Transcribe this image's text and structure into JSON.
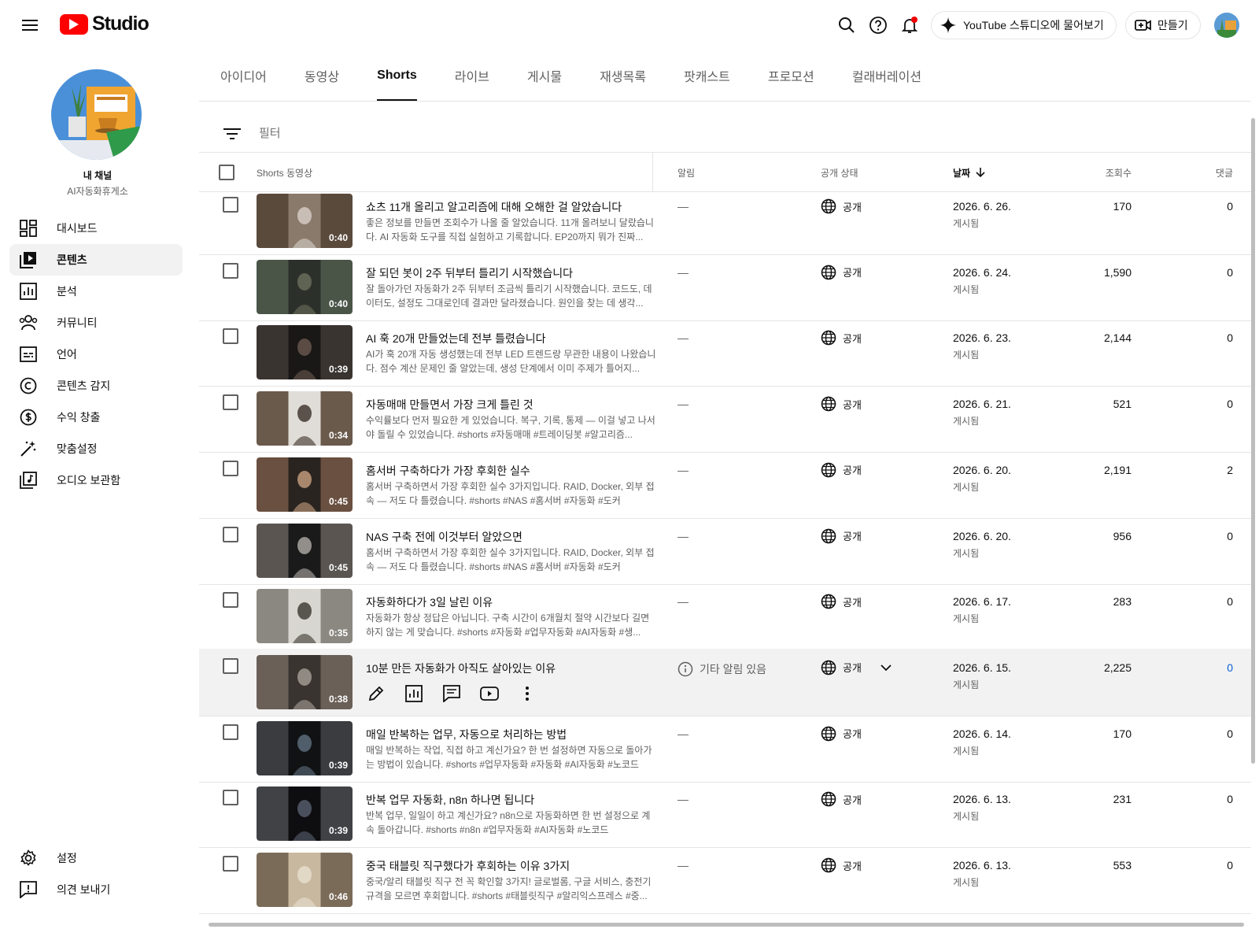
{
  "header": {
    "logo_text": "Studio",
    "ask_label": "YouTube 스튜디오에 물어보기",
    "create_label": "만들기"
  },
  "sidebar": {
    "channel_title": "내 채널",
    "channel_name": "AI자동화휴게소",
    "items": [
      {
        "label": "대시보드",
        "icon": "dashboard-icon"
      },
      {
        "label": "콘텐츠",
        "icon": "content-icon"
      },
      {
        "label": "분석",
        "icon": "analytics-icon"
      },
      {
        "label": "커뮤니티",
        "icon": "community-icon"
      },
      {
        "label": "언어",
        "icon": "subtitles-icon"
      },
      {
        "label": "콘텐츠 감지",
        "icon": "copyright-icon"
      },
      {
        "label": "수익 창출",
        "icon": "dollar-icon"
      },
      {
        "label": "맞춤설정",
        "icon": "magic-wand-icon"
      },
      {
        "label": "오디오 보관함",
        "icon": "audio-library-icon"
      }
    ],
    "settings_label": "설정",
    "feedback_label": "의견 보내기"
  },
  "tabs": [
    "아이디어",
    "동영상",
    "Shorts",
    "라이브",
    "게시물",
    "재생목록",
    "팟캐스트",
    "프로모션",
    "컬래버레이션"
  ],
  "active_tab": "Shorts",
  "filter": {
    "placeholder": "필터"
  },
  "table": {
    "headers": {
      "video": "Shorts 동영상",
      "alerts": "알림",
      "visibility": "공개 상태",
      "date": "날짜",
      "views": "조회수",
      "comments": "댓글"
    },
    "rows": [
      {
        "title": "쇼츠 11개 올리고 알고리즘에 대해 오해한 걸 알았습니다",
        "desc": "좋은 정보를 만들면 조회수가 나올 줄 알았습니다. 11개 올려보니 달랐습니다. AI 자동화 도구를 직접 실험하고 기록합니다. EP20까지 뭐가 진짜...",
        "duration": "0:40",
        "alert": "—",
        "visibility": "공개",
        "date": "2026. 6. 26.",
        "status": "게시됨",
        "views": "170",
        "comments": "0"
      },
      {
        "title": "잘 되던 봇이 2주 뒤부터 틀리기 시작했습니다",
        "desc": "잘 돌아가던 자동화가 2주 뒤부터 조금씩 틀리기 시작했습니다. 코드도, 데이터도, 설정도 그대로인데 결과만 달라졌습니다. 원인을 찾는 데 생각...",
        "duration": "0:40",
        "alert": "—",
        "visibility": "공개",
        "date": "2026. 6. 24.",
        "status": "게시됨",
        "views": "1,590",
        "comments": "0"
      },
      {
        "title": "AI 훅 20개 만들었는데 전부 틀렸습니다",
        "desc": "AI가 훅 20개 자동 생성했는데 전부 LED 트렌드랑 무관한 내용이 나왔습니다. 점수 계산 문제인 줄 알았는데, 생성 단계에서 이미 주제가 틀어지...",
        "duration": "0:39",
        "alert": "—",
        "visibility": "공개",
        "date": "2026. 6. 23.",
        "status": "게시됨",
        "views": "2,144",
        "comments": "0"
      },
      {
        "title": "자동매매 만들면서 가장 크게 틀린 것",
        "desc": "수익률보다 먼저 필요한 게 있었습니다. 복구, 기록, 통제 — 이걸 넣고 나서야 돌릴 수 있었습니다. #shorts #자동매매 #트레이딩봇 #알고리즘...",
        "duration": "0:34",
        "alert": "—",
        "visibility": "공개",
        "date": "2026. 6. 21.",
        "status": "게시됨",
        "views": "521",
        "comments": "0"
      },
      {
        "title": "홈서버 구축하다가 가장 후회한 실수",
        "desc": "홈서버 구축하면서 가장 후회한 실수 3가지입니다. RAID, Docker, 외부 접속 — 저도 다 틀렸습니다. #shorts #NAS #홈서버 #자동화 #도커",
        "duration": "0:45",
        "alert": "—",
        "visibility": "공개",
        "date": "2026. 6. 20.",
        "status": "게시됨",
        "views": "2,191",
        "comments": "2"
      },
      {
        "title": "NAS 구축 전에 이것부터 알았으면",
        "desc": "홈서버 구축하면서 가장 후회한 실수 3가지입니다. RAID, Docker, 외부 접속 — 저도 다 틀렸습니다. #shorts #NAS #홈서버 #자동화 #도커",
        "duration": "0:45",
        "alert": "—",
        "visibility": "공개",
        "date": "2026. 6. 20.",
        "status": "게시됨",
        "views": "956",
        "comments": "0"
      },
      {
        "title": "자동화하다가 3일 날린 이유",
        "desc": "자동화가 항상 정답은 아닙니다. 구축 시간이 6개월치 절약 시간보다 길면 하지 않는 게 맞습니다. #shorts #자동화 #업무자동화 #AI자동화 #생...",
        "duration": "0:35",
        "alert": "—",
        "visibility": "공개",
        "date": "2026. 6. 17.",
        "status": "게시됨",
        "views": "283",
        "comments": "0"
      },
      {
        "title": "10분 만든 자동화가 아직도 살아있는 이유",
        "desc": "",
        "duration": "0:38",
        "alert": "기타 알림 있음",
        "visibility": "공개",
        "date": "2026. 6. 15.",
        "status": "게시됨",
        "views": "2,225",
        "comments": "0"
      },
      {
        "title": "매일 반복하는 업무, 자동으로 처리하는 방법",
        "desc": "매일 반복하는 작업, 직접 하고 계신가요? 한 번 설정하면 자동으로 돌아가는 방법이 있습니다. #shorts #업무자동화 #자동화 #AI자동화 #노코드",
        "duration": "0:39",
        "alert": "—",
        "visibility": "공개",
        "date": "2026. 6. 14.",
        "status": "게시됨",
        "views": "170",
        "comments": "0"
      },
      {
        "title": "반복 업무 자동화, n8n 하나면 됩니다",
        "desc": "반복 업무, 일일이 하고 계신가요? n8n으로 자동화하면 한 번 설정으로 계속 돌아갑니다. #shorts #n8n #업무자동화 #AI자동화 #노코드",
        "duration": "0:39",
        "alert": "—",
        "visibility": "공개",
        "date": "2026. 6. 13.",
        "status": "게시됨",
        "views": "231",
        "comments": "0"
      },
      {
        "title": "중국 태블릿 직구했다가 후회하는 이유 3가지",
        "desc": "중국/알리 태블릿 직구 전 꼭 확인할 3가지! 글로벌롬, 구글 서비스, 충전기 규격을 모르면 후회합니다. #shorts #태블릿직구 #알리익스프레스 #중...",
        "duration": "0:46",
        "alert": "—",
        "visibility": "공개",
        "date": "2026. 6. 13.",
        "status": "게시됨",
        "views": "553",
        "comments": "0"
      }
    ]
  }
}
